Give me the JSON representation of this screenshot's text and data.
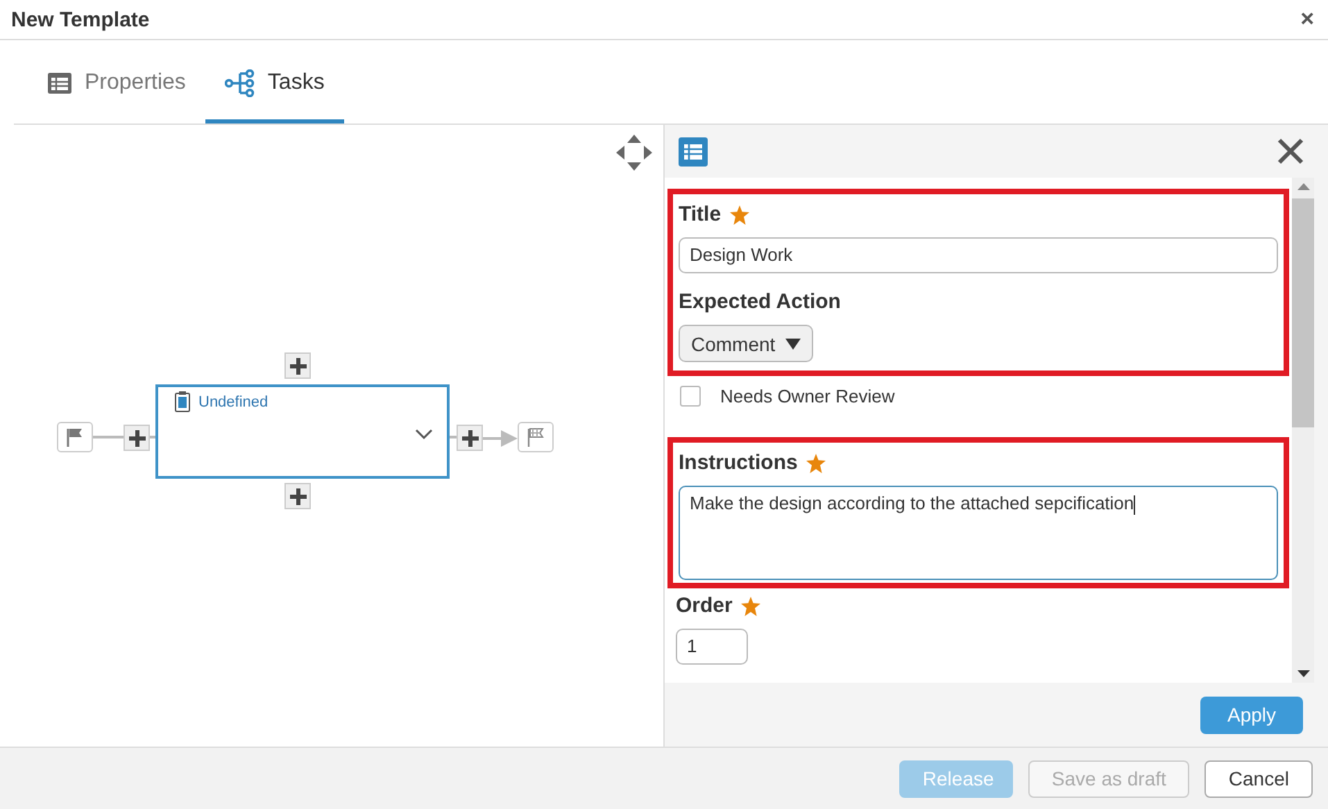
{
  "window": {
    "title": "New Template",
    "close": "×"
  },
  "tabs": [
    {
      "label": "Properties",
      "selected": false
    },
    {
      "label": "Tasks",
      "selected": true
    }
  ],
  "diagram": {
    "task": {
      "label": "Undefined",
      "selected": true
    }
  },
  "panel": {
    "sections": [
      {
        "highlighted": true,
        "fields": [
          {
            "kind": "text",
            "label": "Title",
            "required": true,
            "value": "Design Work"
          },
          {
            "kind": "select",
            "label": "Expected Action",
            "value": "Comment"
          }
        ]
      },
      {
        "highlighted": false,
        "fields": [
          {
            "kind": "checkbox",
            "label": "Needs Owner Review",
            "checked": false
          }
        ]
      },
      {
        "highlighted": true,
        "fields": [
          {
            "kind": "textarea",
            "label": "Instructions",
            "required": true,
            "value": "Make the design according to the attached sepcification"
          }
        ]
      },
      {
        "highlighted": false,
        "fields": [
          {
            "kind": "number",
            "label": "Order",
            "required": true,
            "value": "1"
          }
        ]
      }
    ],
    "apply": "Apply"
  },
  "footer": [
    {
      "label": "Release",
      "kind": "primary",
      "disabled": true
    },
    {
      "label": "Save as draft",
      "kind": "default",
      "disabled": true
    },
    {
      "label": "Cancel",
      "kind": "default",
      "disabled": false
    }
  ]
}
